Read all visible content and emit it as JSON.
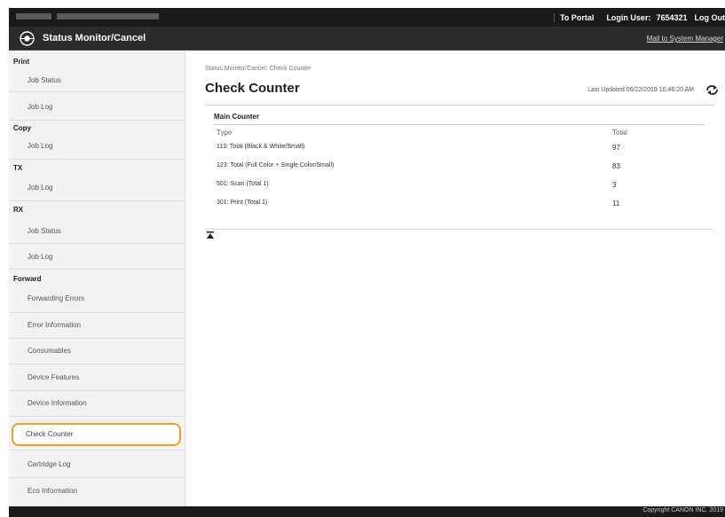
{
  "topbar": {
    "url_text": "",
    "portal": "To Portal",
    "login_label": "Login User:",
    "login_user": "7654321",
    "logout": "Log Out"
  },
  "header": {
    "title": "Status Monitor/Cancel",
    "mail_link": "Mail to System Manager"
  },
  "sidebar": {
    "sections": [
      {
        "heading": "Print",
        "items": [
          "Job Status",
          "Job Log"
        ]
      },
      {
        "heading": "Copy",
        "items": [
          "Job Log"
        ]
      },
      {
        "heading": "TX",
        "items": [
          "Job Log"
        ]
      },
      {
        "heading": "RX",
        "items": [
          "Job Status",
          "Job Log"
        ]
      },
      {
        "heading": "Forward",
        "items": [
          "Forwarding Errors"
        ]
      }
    ],
    "items": [
      "Error Information",
      "Consumables",
      "Device Features",
      "Device Information",
      "Check Counter",
      "Cartridge Log",
      "Eco Information"
    ],
    "selected": "Check Counter"
  },
  "main": {
    "breadcrumb": "Status Monitor/Cancel: Check Counter",
    "title": "Check Counter",
    "last_updated": "Last Updated:06/22/2019 10:46:20 AM",
    "counter": {
      "heading": "Main Counter",
      "col_type": "Type",
      "col_total": "Total",
      "rows": [
        {
          "type": "113: Total (Black & White/Small)",
          "total": "97"
        },
        {
          "type": "123: Total (Full Color + Single Color/Small)",
          "total": "83"
        },
        {
          "type": "501: Scan (Total 1)",
          "total": "3"
        },
        {
          "type": "301: Print (Total 1)",
          "total": "11"
        }
      ]
    }
  },
  "footer": {
    "copyright": "Copyright CANON INC. 2019"
  },
  "colors": {
    "topbar": "#1a1a1a",
    "titlebar": "#2b2b2b",
    "sidebar_bg": "#f2f2f2",
    "highlight": "#f0a020"
  },
  "icons": {
    "logo": "canon-logo-icon",
    "refresh": "refresh-icon",
    "page_top": "page-top-icon"
  }
}
